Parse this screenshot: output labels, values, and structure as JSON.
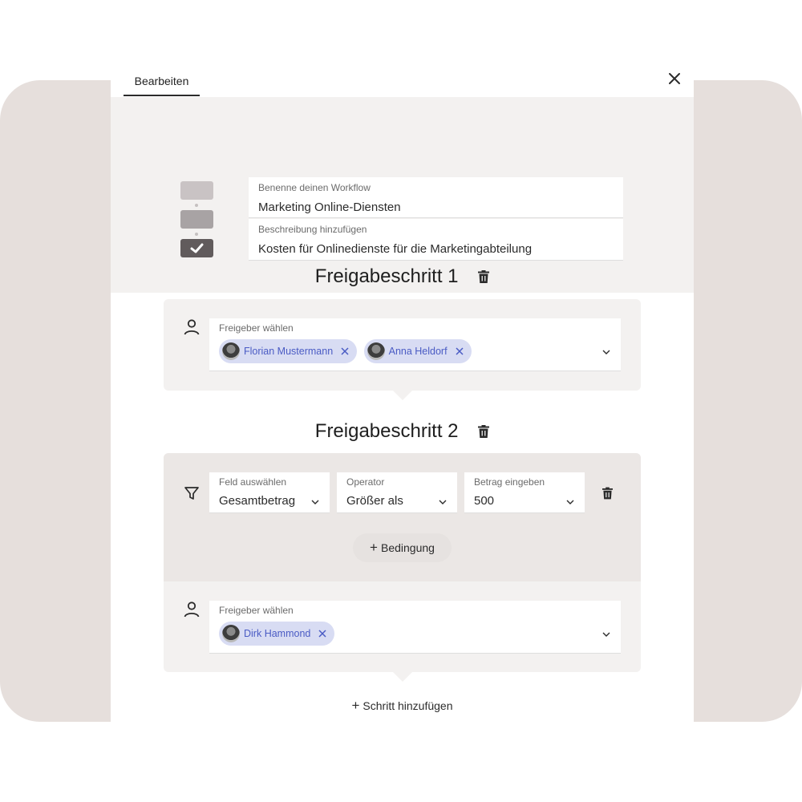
{
  "header": {
    "tab_label": "Bearbeiten"
  },
  "workflow": {
    "name_label": "Benenne deinen Workflow",
    "name_value": "Marketing Online-Diensten",
    "description_label": "Beschreibung hinzufügen",
    "description_value": "Kosten für Onlinedienste für die Marketingabteilung"
  },
  "steps": [
    {
      "title": "Freigabeschritt 1",
      "approver_label": "Freigeber wählen",
      "approvers": [
        {
          "name": "Florian Mustermann"
        },
        {
          "name": "Anna Heldorf"
        }
      ]
    },
    {
      "title": "Freigabeschritt 2",
      "conditions": [
        {
          "label": "Feld auswählen",
          "value": "Gesamtbetrag"
        },
        {
          "label": "Operator",
          "value": "Größer als"
        },
        {
          "label": "Betrag eingeben",
          "value": "500"
        }
      ],
      "add_condition_label": "Bedingung",
      "approver_label": "Freigeber wählen",
      "approvers": [
        {
          "name": "Dirk Hammond"
        }
      ]
    }
  ],
  "footer": {
    "add_step_label": "Schritt hinzufügen"
  },
  "colors": {
    "background_band": "#e6dfdc",
    "section_bg": "#f3f1f0",
    "chip_bg": "#d8dcf3",
    "chip_text": "#4a5bc4"
  },
  "icons": [
    "close-icon",
    "trash-icon",
    "person-icon",
    "filter-icon",
    "chevron-down-icon",
    "remove-icon",
    "plus-icon",
    "workflow-steps-icon"
  ]
}
